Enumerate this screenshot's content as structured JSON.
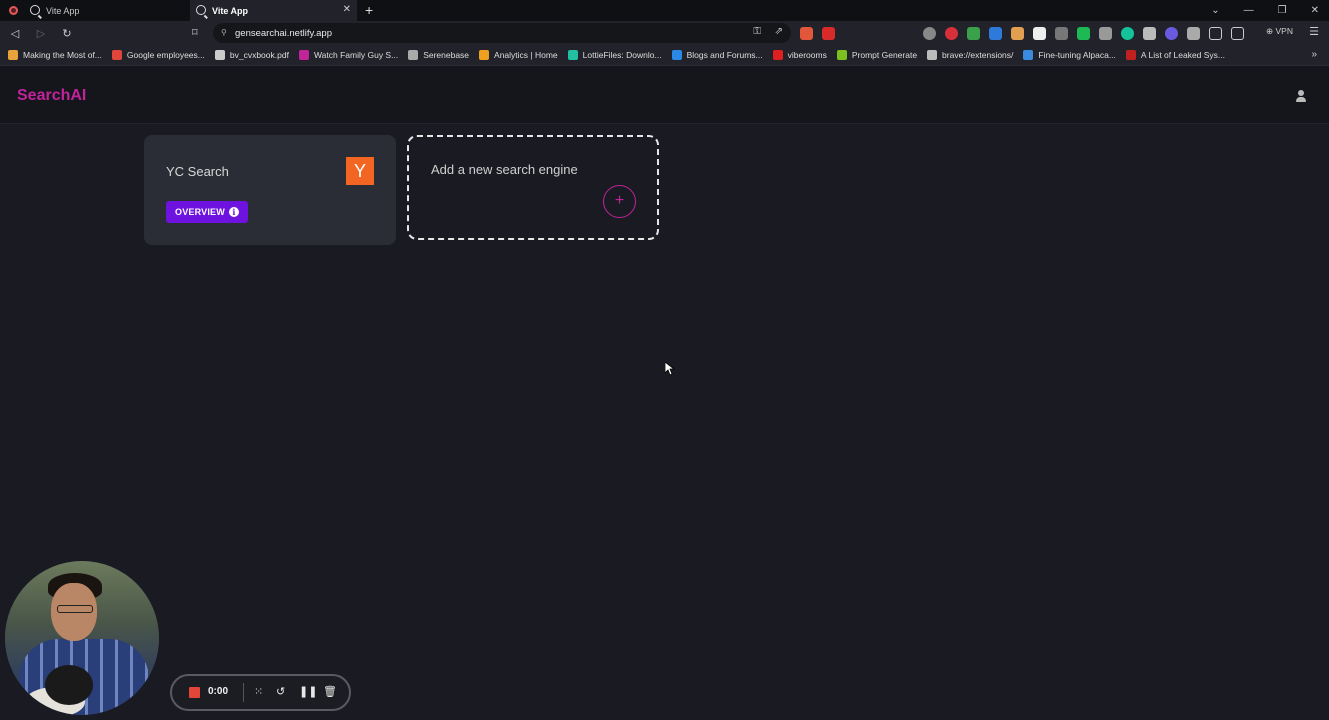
{
  "browser": {
    "tabs": [
      {
        "label": "Vite App",
        "active": false
      },
      {
        "label": "Vite App",
        "active": true
      }
    ],
    "url": "gensearchai.netlify.app",
    "vpn_label": "VPN",
    "bookmarks": [
      {
        "label": "Making the Most of...",
        "color": "#e8a33a"
      },
      {
        "label": "Google employees...",
        "color": "#e2463a"
      },
      {
        "label": "bv_cvxbook.pdf",
        "color": "#cccccc"
      },
      {
        "label": "Watch Family Guy S...",
        "color": "#c0239a"
      },
      {
        "label": "Serenebase",
        "color": "#aaaaaa"
      },
      {
        "label": "Analytics | Home",
        "color": "#f0a020"
      },
      {
        "label": "LottieFiles: Downlo...",
        "color": "#22c0a0"
      },
      {
        "label": "Blogs and Forums...",
        "color": "#2a88e6"
      },
      {
        "label": "viberooms",
        "color": "#e02020"
      },
      {
        "label": "Prompt Generate",
        "color": "#7cc020"
      },
      {
        "label": "brave://extensions/",
        "color": "#bbbbbb"
      },
      {
        "label": "Fine-tuning Alpaca...",
        "color": "#3a8ae0"
      },
      {
        "label": "A List of Leaked Sys...",
        "color": "#c02020"
      }
    ]
  },
  "app": {
    "logo": "SearchAI",
    "cards": [
      {
        "title": "YC Search",
        "logo_letter": "Y",
        "button_label": "OVERVIEW"
      }
    ],
    "add_card": {
      "title": "Add a new search engine",
      "plus": "+"
    }
  },
  "recorder": {
    "time": "0:00"
  },
  "colors": {
    "brand": "#c0239a",
    "button": "#6e12e0",
    "yc_orange": "#f26522"
  }
}
